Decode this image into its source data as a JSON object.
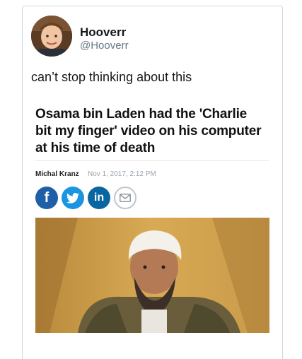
{
  "tweet": {
    "display_name": "Hooverr",
    "handle": "@Hooverr",
    "text": "can’t stop thinking about this"
  },
  "article": {
    "headline": "Osama bin Laden had the 'Charlie bit my finger' video on his computer at his time of death",
    "author": "Michal Kranz",
    "date": "Nov 1, 2017, 2:12 PM",
    "share": {
      "facebook_icon": "f",
      "twitter_icon": "twitter-bird",
      "linkedin_icon": "in",
      "email_icon": "envelope"
    }
  },
  "colors": {
    "facebook": "#1e5fa8",
    "twitter": "#1b95e0",
    "linkedin": "#0a66a2",
    "handle_gray": "#657786"
  }
}
